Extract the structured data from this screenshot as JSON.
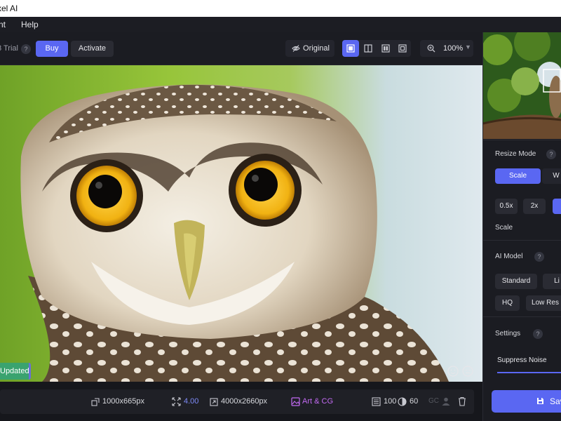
{
  "window": {
    "title": "xel AI"
  },
  "menu": {
    "item1": "nt",
    "help": "Help"
  },
  "toolbar": {
    "trial": "3 Trial",
    "help": "?",
    "buy": "Buy",
    "activate": "Activate",
    "original": "Original",
    "zoom": "100%"
  },
  "canvas": {
    "badge": "Updated",
    "subject": "owl photo"
  },
  "status": {
    "source_size": "1000x665px",
    "scale": "4.00",
    "output_size": "4000x2660px",
    "mode": "Art & CG",
    "quality": "100",
    "volume": "60",
    "gc": "GC"
  },
  "panel": {
    "resize_mode": "Resize Mode",
    "scale_tab": "Scale",
    "width_tab": "W",
    "scale_05": "0.5x",
    "scale_2": "2x",
    "scale_label": "Scale",
    "ai_model": "AI Model",
    "standard": "Standard",
    "lite": "Li",
    "hq": "HQ",
    "lowres": "Low Res",
    "settings": "Settings",
    "suppress_noise": "Suppress Noise",
    "save": "Sav",
    "help": "?"
  },
  "colors": {
    "accent": "#5a67f2",
    "badge": "#3aa36f",
    "mode": "#c26af2"
  }
}
